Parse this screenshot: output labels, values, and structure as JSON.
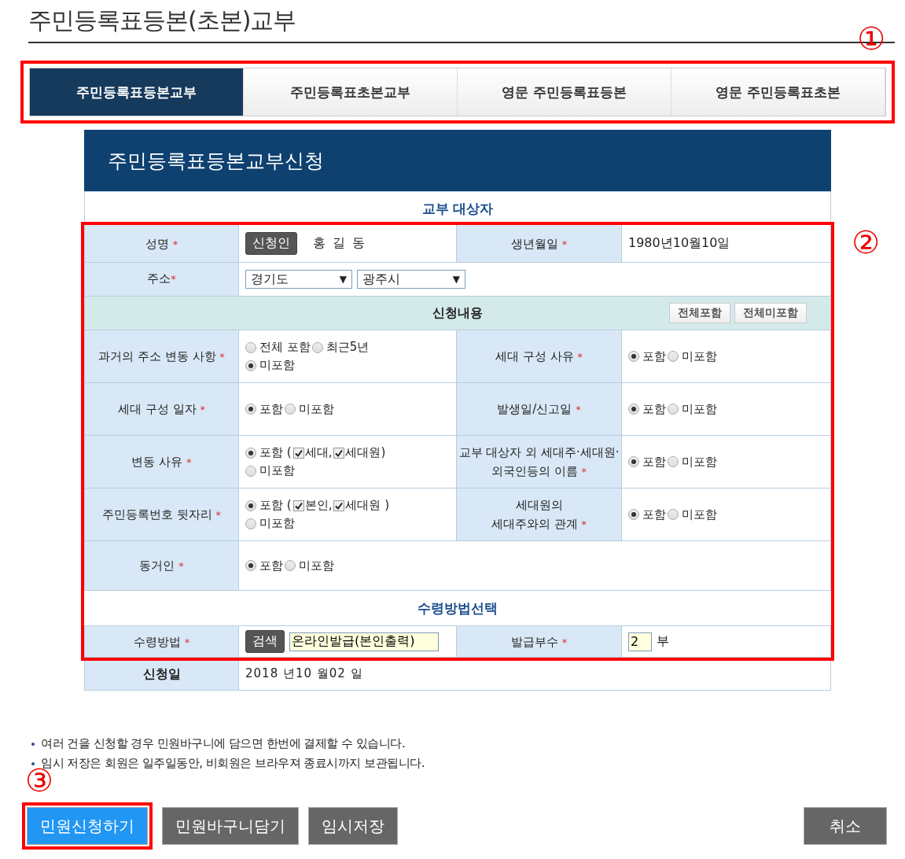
{
  "page_title": "주민등록표등본(초본)교부",
  "tabs_panel": {
    "annotation": "①",
    "tabs": [
      {
        "label": "주민등록표등본교부",
        "selected": true
      },
      {
        "label": "주민등록표초본교부",
        "selected": false
      },
      {
        "label": "영문 주민등록표등본",
        "selected": false
      },
      {
        "label": "영문 주민등록표초본",
        "selected": false
      }
    ]
  },
  "form": {
    "title": "주민등록표등본교부신청",
    "target_heading": "교부 대상자",
    "annotation": "②",
    "applicant": {
      "label": "성명",
      "mark": "*",
      "button": "신청인",
      "name": "홍 길 동",
      "birth_label": "생년월일",
      "birth_mark": "*",
      "birth": "1980년10월10일"
    },
    "address": {
      "label": "주소",
      "mark": "*",
      "selects": [
        {
          "value": "경기도",
          "arrow": "▼"
        },
        {
          "value": "광주시",
          "arrow": "▼"
        }
      ]
    },
    "contents": {
      "heading": "신청내용",
      "buttons": [
        "전체포함",
        "전체미포함"
      ]
    },
    "option_rows": [
      {
        "cells": [
          {
            "label_lines": [
              "과거의 주소 변동 사항"
            ],
            "mark": "*",
            "lines": [
              [
                {
                  "label": "전체 포함",
                  "selected": false
                },
                {
                  "label": "최근5년",
                  "selected": false
                }
              ],
              [
                {
                  "label": "미포함",
                  "selected": true
                }
              ]
            ]
          },
          {
            "label_lines": [
              "세대 구성 사유"
            ],
            "mark": "*",
            "lines": [
              [
                {
                  "label": "포함",
                  "selected": true
                },
                {
                  "label": "미포함",
                  "selected": false
                }
              ]
            ]
          }
        ]
      },
      {
        "cells": [
          {
            "label_lines": [
              "세대 구성 일자"
            ],
            "mark": "*",
            "lines": [
              [
                {
                  "label": "포함",
                  "selected": true
                },
                {
                  "label": "미포함",
                  "selected": false
                }
              ]
            ]
          },
          {
            "label_lines": [
              "발생일/신고일"
            ],
            "mark": "*",
            "lines": [
              [
                {
                  "label": "포함",
                  "selected": true
                },
                {
                  "label": "미포함",
                  "selected": false
                }
              ]
            ]
          }
        ]
      },
      {
        "cells": [
          {
            "label_lines": [
              "변동 사유"
            ],
            "mark": "*",
            "lines": [
              [
                {
                  "label": "포함 (",
                  "selected": true,
                  "checkboxes": [
                    {
                      "label": "세대,",
                      "checked": true
                    },
                    {
                      "label": "세대원)",
                      "checked": true
                    }
                  ]
                }
              ],
              [
                {
                  "label": "미포함",
                  "selected": false
                }
              ]
            ]
          },
          {
            "label_lines": [
              "교부 대상자 외 세대주·세대원·",
              "외국인등의 이름"
            ],
            "mark": "*",
            "lines": [
              [
                {
                  "label": "포함",
                  "selected": true
                },
                {
                  "label": "미포함",
                  "selected": false
                }
              ]
            ]
          }
        ]
      },
      {
        "cells": [
          {
            "label_lines": [
              "주민등록번호 뒷자리"
            ],
            "mark": "*",
            "lines": [
              [
                {
                  "label": "포함 (",
                  "selected": true,
                  "checkboxes": [
                    {
                      "label": "본인,",
                      "checked": true
                    },
                    {
                      "label": "세대원 )",
                      "checked": true
                    }
                  ]
                }
              ],
              [
                {
                  "label": "미포함",
                  "selected": false
                }
              ]
            ]
          },
          {
            "label_lines": [
              "세대원의",
              "세대주와의 관계"
            ],
            "mark": "*",
            "lines": [
              [
                {
                  "label": "포함",
                  "selected": true
                },
                {
                  "label": "미포함",
                  "selected": false
                }
              ]
            ]
          }
        ]
      },
      {
        "cells": [
          {
            "label_lines": [
              "동거인"
            ],
            "mark": "*",
            "lines": [
              [
                {
                  "label": "포함",
                  "selected": true
                },
                {
                  "label": "미포함",
                  "selected": false
                }
              ]
            ]
          }
        ]
      }
    ],
    "receive_heading": "수령방법선택",
    "receive": {
      "label": "수령방법",
      "mark": "*",
      "button": "검색",
      "value": "온라인발급(본인출력)",
      "copies_label": "발급부수",
      "copies_mark": "*",
      "copies": "2",
      "unit": "부"
    },
    "date": {
      "label": "신청일",
      "value": "2018  년10 월02 일"
    }
  },
  "notes": [
    "여러 건을 신청할 경우 민원바구니에 담으면 한번에 결제할 수 있습니다.",
    "임시 저장은 회원은 일주일동안, 비회원은 브라우져 종료시까지 보관됩니다."
  ],
  "actions": [
    {
      "label": "민원신청하기",
      "kind": "primary",
      "annotation": "③"
    },
    {
      "label": "민원바구니담기",
      "kind": "secondary"
    },
    {
      "label": "임시저장",
      "kind": "secondary"
    },
    {
      "label": "취소",
      "kind": "cancel"
    }
  ]
}
